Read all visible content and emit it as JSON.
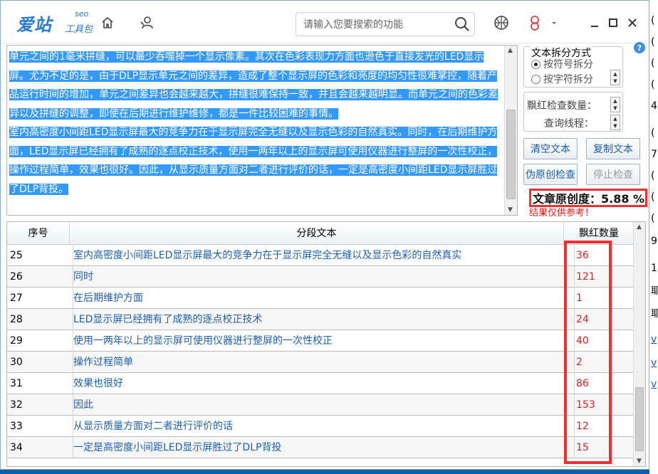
{
  "app": {
    "logo_main": "爱站",
    "logo_seo": "seo",
    "logo_tool": "工具包"
  },
  "search": {
    "placeholder": "请输入您要搜索的功能"
  },
  "editor": {
    "paragraphs": [
      "单元之间的1毫米拼缝，可以最少吞噬掉一个显示像素。其次在色彩表现力方面也逊色于直接发光的LED显示屏。尤为不足的是，由于DLP显示单元之间的差异，造成了整个显示屏的色彩和亮度的均匀性很难掌控，随着产品运行时间的增加，单元之间差异也会越来越大，拼缝很难保持一致，并且会越来越明显。而单元之间的色彩差异以及拼缝的调整，即使在后期进行维护维修，都是一件比较困难的事情。",
      "室内高密度小间距LED显示屏最大的竞争力在于显示屏完全无缝以及显示色彩的自然真实。同时，在后期维护方面，LED显示屏已经拥有了成熟的逐点校正技术，使用一两年以上的显示屏可使用仪器进行整屏的一次性校正，操作过程简单，效果也很好。因此，从显示质量方面对二者进行评价的话，一定是高密度小间距LED显示屏胜过了DLP背投。"
    ]
  },
  "split_options": {
    "title": "文本拆分方式",
    "option_symbol": "按符号拆分",
    "option_char": "按字符拆分",
    "selected": "按符号拆分"
  },
  "check_settings": {
    "red_count_label": "飘红检查数量：",
    "threads_label": "查询线程："
  },
  "buttons": {
    "clear": "清空文本",
    "copy": "复制文本",
    "pseudo_check": "伪原创检查",
    "stop_check": "停止检查"
  },
  "result": {
    "originality": "文章原创度：5.88 %",
    "note": "结果仅供参考！"
  },
  "table": {
    "headers": [
      "序号",
      "分段文本",
      "飘红数量"
    ],
    "rows": [
      {
        "num": "25",
        "text": "室内高密度小间距LED显示屏最大的竞争力在于显示屏完全无缝以及显示色彩的自然真实",
        "count": "36"
      },
      {
        "num": "26",
        "text": "同时",
        "count": "121"
      },
      {
        "num": "27",
        "text": "在后期维护方面",
        "count": "1"
      },
      {
        "num": "28",
        "text": "LED显示屏已经拥有了成熟的逐点校正技术",
        "count": "24"
      },
      {
        "num": "29",
        "text": "使用一两年以上的显示屏可使用仪器进行整屏的一次性校正",
        "count": "40"
      },
      {
        "num": "30",
        "text": "操作过程简单",
        "count": "2"
      },
      {
        "num": "31",
        "text": "效果也很好",
        "count": "86"
      },
      {
        "num": "32",
        "text": "因此",
        "count": "153"
      },
      {
        "num": "33",
        "text": "从显示质量方面对二者进行评价的话",
        "count": "12"
      },
      {
        "num": "34",
        "text": "一定是高密度小间距LED显示屏胜过了DLP背投",
        "count": "15"
      }
    ]
  },
  "background_window": {
    "lines": [
      "(",
      "(",
      "(",
      "(",
      "4",
      "(",
      "7",
      "(",
      "(",
      "(",
      "9",
      "1",
      "耶",
      "耶"
    ],
    "links": [
      "v",
      "v",
      "v"
    ]
  },
  "colors": {
    "accent": "#2a7bd3",
    "highlight": "#3399ff",
    "link": "#1a5fb4",
    "alert": "#f03030"
  }
}
